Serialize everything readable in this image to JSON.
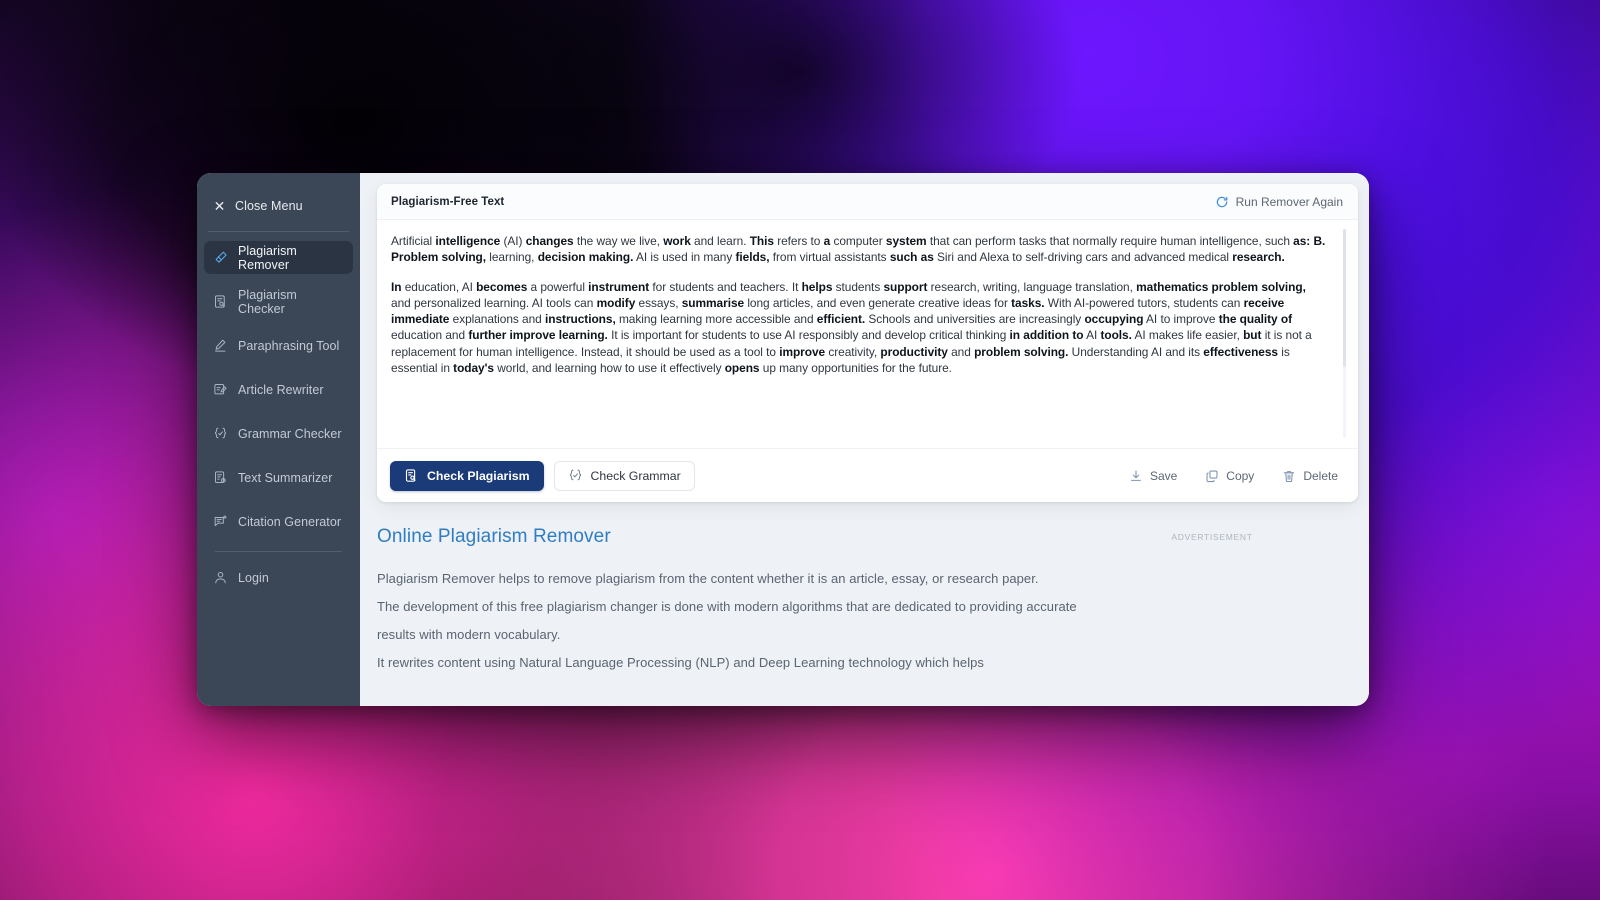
{
  "sidebar": {
    "close_menu_label": "Close Menu",
    "items": [
      {
        "label": "Plagiarism Remover",
        "icon": "eraser-icon",
        "active": true
      },
      {
        "label": "Plagiarism Checker",
        "icon": "document-search-icon",
        "active": false
      },
      {
        "label": "Paraphrasing Tool",
        "icon": "pencil-line-icon",
        "active": false
      },
      {
        "label": "Article Rewriter",
        "icon": "document-edit-icon",
        "active": false
      },
      {
        "label": "Grammar Checker",
        "icon": "braces-check-icon",
        "active": false
      },
      {
        "label": "Text Summarizer",
        "icon": "document-clock-icon",
        "active": false
      },
      {
        "label": "Citation Generator",
        "icon": "quote-bubble-icon",
        "active": false
      }
    ],
    "login_label": "Login",
    "login_icon": "user-icon"
  },
  "editor": {
    "title": "Plagiarism-Free Text",
    "run_again_label": "Run Remover Again",
    "run_again_icon": "refresh-icon",
    "paragraphs": [
      [
        {
          "t": "Artificial ",
          "b": false
        },
        {
          "t": "intelligence",
          "b": true
        },
        {
          "t": " (AI) ",
          "b": false
        },
        {
          "t": "changes",
          "b": true
        },
        {
          "t": " the way we live, ",
          "b": false
        },
        {
          "t": "work",
          "b": true
        },
        {
          "t": " and learn. ",
          "b": false
        },
        {
          "t": "This",
          "b": true
        },
        {
          "t": " refers to ",
          "b": false
        },
        {
          "t": "a",
          "b": true
        },
        {
          "t": " computer ",
          "b": false
        },
        {
          "t": "system",
          "b": true
        },
        {
          "t": " that can perform tasks that normally require human intelligence, such ",
          "b": false
        },
        {
          "t": "as: B. Problem solving,",
          "b": true
        },
        {
          "t": " learning, ",
          "b": false
        },
        {
          "t": "decision making.",
          "b": true
        },
        {
          "t": " AI is used in many ",
          "b": false
        },
        {
          "t": "fields,",
          "b": true
        },
        {
          "t": " from virtual assistants ",
          "b": false
        },
        {
          "t": "such as",
          "b": true
        },
        {
          "t": " Siri and Alexa to self-driving cars and advanced medical ",
          "b": false
        },
        {
          "t": "research.",
          "b": true
        }
      ],
      [
        {
          "t": "In",
          "b": true
        },
        {
          "t": " education, AI ",
          "b": false
        },
        {
          "t": "becomes",
          "b": true
        },
        {
          "t": " a powerful ",
          "b": false
        },
        {
          "t": "instrument",
          "b": true
        },
        {
          "t": " for students and teachers. It ",
          "b": false
        },
        {
          "t": "helps",
          "b": true
        },
        {
          "t": " students ",
          "b": false
        },
        {
          "t": "support",
          "b": true
        },
        {
          "t": " research, writing, language translation, ",
          "b": false
        },
        {
          "t": "mathematics problem solving,",
          "b": true
        },
        {
          "t": " and personalized learning. AI tools can ",
          "b": false
        },
        {
          "t": "modify",
          "b": true
        },
        {
          "t": " essays, ",
          "b": false
        },
        {
          "t": "summarise",
          "b": true
        },
        {
          "t": " long articles, and even generate creative ideas for ",
          "b": false
        },
        {
          "t": "tasks.",
          "b": true
        },
        {
          "t": " With AI-powered tutors, students can ",
          "b": false
        },
        {
          "t": "receive immediate",
          "b": true
        },
        {
          "t": " explanations and ",
          "b": false
        },
        {
          "t": "instructions,",
          "b": true
        },
        {
          "t": " making learning more accessible and ",
          "b": false
        },
        {
          "t": "efficient.",
          "b": true
        },
        {
          "t": " Schools and universities are increasingly ",
          "b": false
        },
        {
          "t": "occupying",
          "b": true
        },
        {
          "t": " AI to improve ",
          "b": false
        },
        {
          "t": "the quality of",
          "b": true
        },
        {
          "t": " education and ",
          "b": false
        },
        {
          "t": "further improve learning.",
          "b": true
        },
        {
          "t": " It is important for students to use AI responsibly and develop critical thinking ",
          "b": false
        },
        {
          "t": "in addition to",
          "b": true
        },
        {
          "t": " AI ",
          "b": false
        },
        {
          "t": "tools.",
          "b": true
        },
        {
          "t": " AI makes life easier, ",
          "b": false
        },
        {
          "t": "but",
          "b": true
        },
        {
          "t": " it is not a replacement for human intelligence. Instead, it should be used as a tool to ",
          "b": false
        },
        {
          "t": "improve",
          "b": true
        },
        {
          "t": " creativity, ",
          "b": false
        },
        {
          "t": "productivity",
          "b": true
        },
        {
          "t": " and ",
          "b": false
        },
        {
          "t": "problem solving.",
          "b": true
        },
        {
          "t": " Understanding AI and its ",
          "b": false
        },
        {
          "t": "effectiveness",
          "b": true
        },
        {
          "t": " is essential in ",
          "b": false
        },
        {
          "t": "today's",
          "b": true
        },
        {
          "t": " world, and learning how to use it effectively ",
          "b": false
        },
        {
          "t": "opens",
          "b": true
        },
        {
          "t": " up many opportunities for the future.",
          "b": false
        }
      ]
    ],
    "primary_button": {
      "label": "Check Plagiarism",
      "icon": "document-search-icon"
    },
    "secondary_button": {
      "label": "Check Grammar",
      "icon": "braces-check-icon"
    },
    "actions": [
      {
        "label": "Save",
        "icon": "download-icon"
      },
      {
        "label": "Copy",
        "icon": "copy-icon"
      },
      {
        "label": "Delete",
        "icon": "trash-icon"
      }
    ]
  },
  "article": {
    "heading": "Online Plagiarism Remover",
    "p1": "Plagiarism Remover helps to remove plagiarism from the content whether it is an article, essay, or research paper.",
    "p2": "The development of this free plagiarism changer is done with modern algorithms that are dedicated to providing accurate results with modern vocabulary.",
    "p3": "It rewrites content using Natural Language Processing (NLP) and Deep Learning technology which helps"
  },
  "ad": {
    "label": "ADVERTISEMENT"
  },
  "colors": {
    "sidebar_bg": "#3b4656",
    "sidebar_active_bg": "#2b3442",
    "primary_button_bg": "#1b3a78",
    "heading_blue": "#2f7dc4",
    "page_bg": "#eef1f5"
  }
}
